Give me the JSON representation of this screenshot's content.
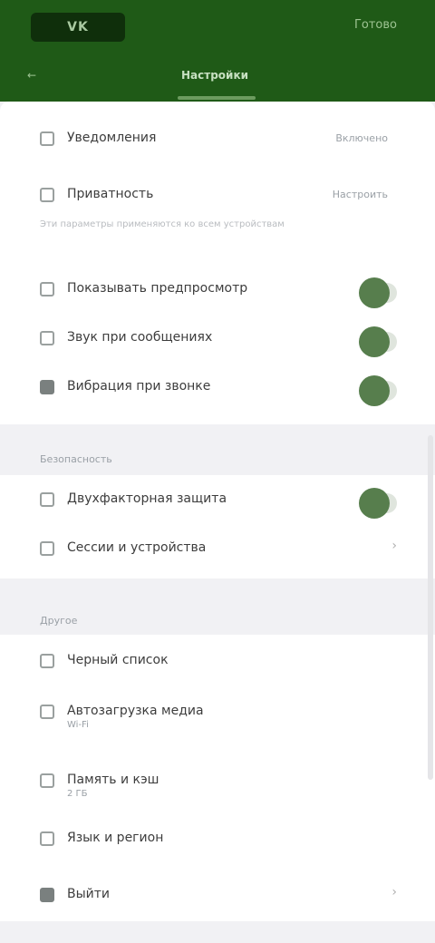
{
  "header": {
    "logo_text": "VK",
    "action_label": "Готово",
    "back_label": "←",
    "active_tab_label": "Настройки"
  },
  "general": {
    "rows": [
      {
        "label": "Уведомления",
        "value": "Включено"
      },
      {
        "label": "Приватность",
        "value": "Настроить"
      }
    ],
    "hint": "Эти параметры применяются ко всем устройствам",
    "toggles": [
      {
        "label": "Показывать предпросмотр",
        "on": true
      },
      {
        "label": "Звук при сообщениях",
        "on": true
      },
      {
        "label": "Вибрация при звонке",
        "on": true
      }
    ]
  },
  "security": {
    "title": "Безопасность",
    "toggle_row": {
      "label": "Двухфакторная защита",
      "on": true
    },
    "row": {
      "label": "Сессии и устройства"
    }
  },
  "other": {
    "title": "Другое",
    "rows": [
      {
        "label": "Черный список",
        "sub": ""
      },
      {
        "label": "Автозагрузка медиа",
        "sub": "Wi-Fi"
      },
      {
        "label": "Память и кэш",
        "sub": "2 ГБ"
      },
      {
        "label": "Язык и регион",
        "sub": ""
      },
      {
        "label": "Выйти",
        "sub": ""
      }
    ]
  },
  "colors": {
    "brand": "#1f5a17",
    "toggle_knob": "#577e4d"
  }
}
